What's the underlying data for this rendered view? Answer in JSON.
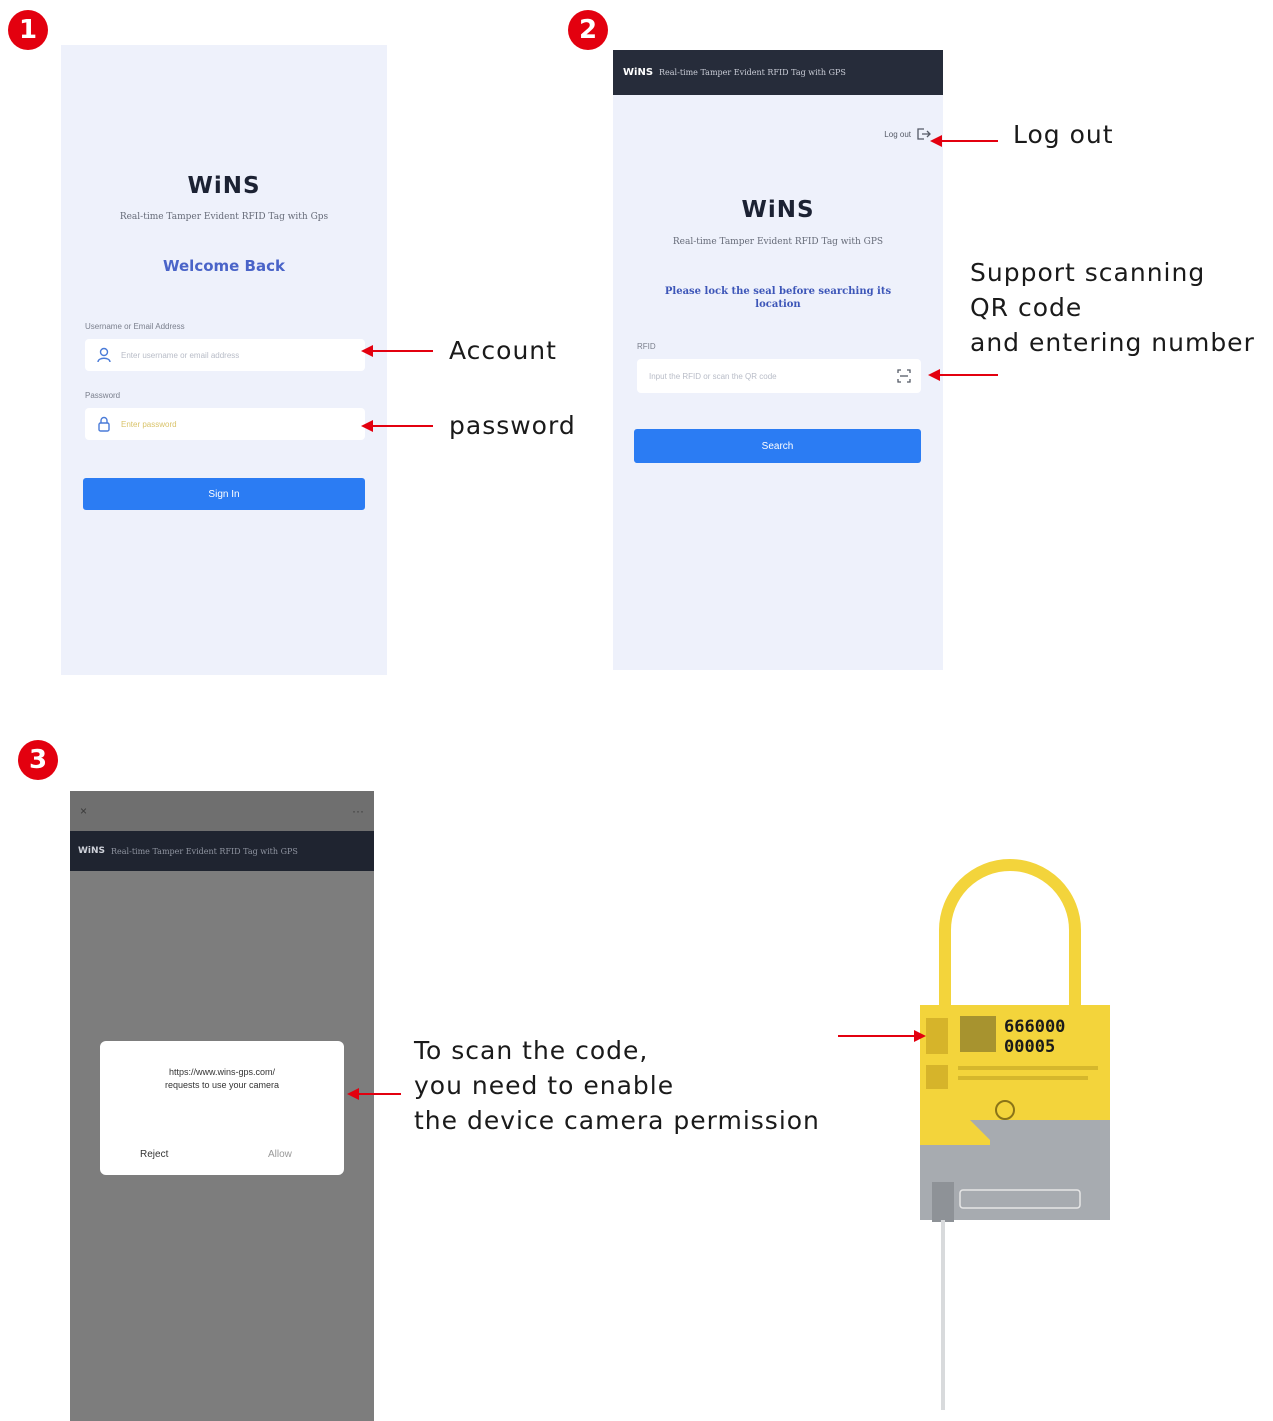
{
  "steps": {
    "one": "1",
    "two": "2",
    "three": "3"
  },
  "screen1": {
    "logo": "WiNS",
    "subtitle": "Real-time Tamper Evident RFID Tag with Gps",
    "welcome": "Welcome Back",
    "username_label": "Username or Email Address",
    "username_placeholder": "Enter username or email address",
    "password_label": "Password",
    "password_placeholder": "Enter password",
    "signin_button": "Sign In"
  },
  "screen2": {
    "header_logo": "WiNS",
    "header_title": "Real-time Tamper Evident RFID Tag with GPS",
    "logout_label": "Log out",
    "logo": "WiNS",
    "subtitle": "Real-time Tamper Evident RFID Tag with GPS",
    "notice": "Please lock the seal before searching its location",
    "rfid_label": "RFID",
    "rfid_placeholder": "Input the RFID or scan the QR code",
    "search_button": "Search"
  },
  "screen3": {
    "close_glyph": "×",
    "menu_glyph": "···",
    "header_logo": "WiNS",
    "header_title": "Real-time Tamper Evident RFID Tag with GPS",
    "dialog_line1": "https://www.wins-gps.com/",
    "dialog_line2": "requests to use your camera",
    "reject_button": "Reject",
    "allow_button": "Allow"
  },
  "annotations": {
    "logout": "Log out",
    "account": "Account",
    "password": "password",
    "scan_line1": "Support scanning",
    "scan_line2": "QR code",
    "scan_line3": "and entering number",
    "camera_line1": "To scan the code,",
    "camera_line2": "you need to enable",
    "camera_line3": "the device camera permission"
  },
  "device": {
    "code_top": "666000",
    "code_bottom": "00005"
  },
  "colors": {
    "accent_red": "#e3000f",
    "primary_blue": "#2b7cf3",
    "header_dark": "#262c3a",
    "screen_bg": "#eef1fb",
    "overlay_gray": "#7d7d7d",
    "seal_yellow": "#f3d43b",
    "seal_gray": "#a7abb0"
  },
  "icons": {
    "user": "user-icon",
    "lock": "lock-icon",
    "logout": "logout-icon",
    "scan": "qr-scan-icon"
  }
}
